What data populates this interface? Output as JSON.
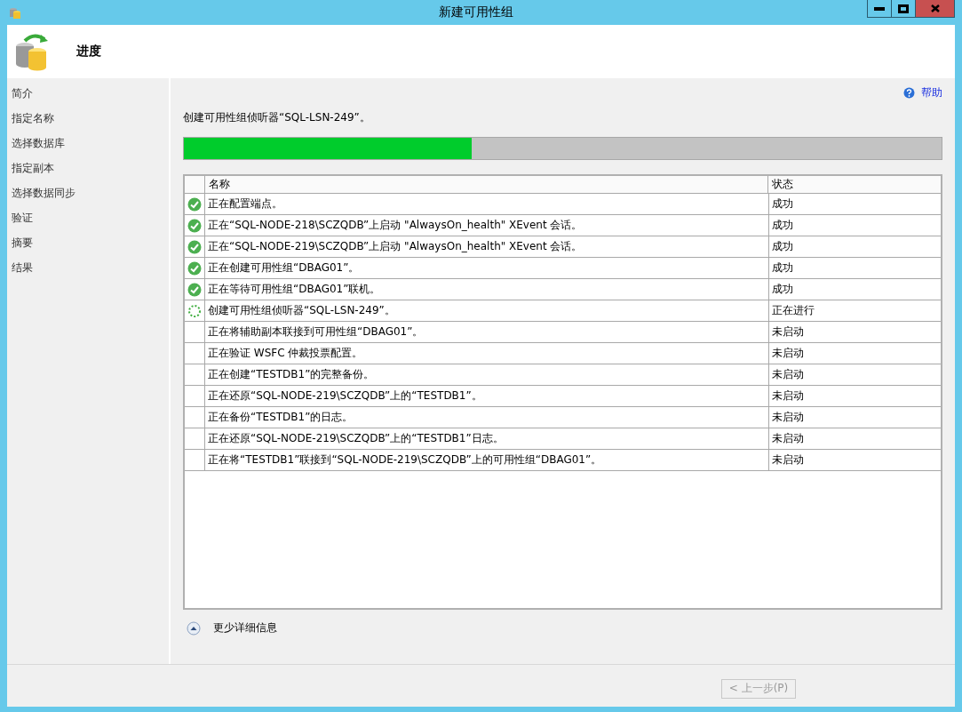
{
  "window": {
    "title": "新建可用性组"
  },
  "header": {
    "title": "进度"
  },
  "sidebar": {
    "items": [
      {
        "label": "简介",
        "selected": false
      },
      {
        "label": "指定名称",
        "selected": false
      },
      {
        "label": "选择数据库",
        "selected": false
      },
      {
        "label": "指定副本",
        "selected": false
      },
      {
        "label": "选择数据同步",
        "selected": false
      },
      {
        "label": "验证",
        "selected": false
      },
      {
        "label": "摘要",
        "selected": false
      },
      {
        "label": "结果",
        "selected": false
      }
    ]
  },
  "help_link": "帮助",
  "current_step": "创建可用性组侦听器“SQL-LSN-249”。",
  "progress": {
    "level": 0.38
  },
  "table": {
    "columns": [
      "名称",
      "状态"
    ],
    "rows": [
      {
        "kind": "done",
        "name": "正在配置端点。",
        "status": "成功"
      },
      {
        "kind": "done",
        "name": "正在“SQL-NODE-218\\SCZQDB”上启动 \"AlwaysOn_health\" XEvent 会话。",
        "status": "成功"
      },
      {
        "kind": "done",
        "name": "正在“SQL-NODE-219\\SCZQDB”上启动 \"AlwaysOn_health\" XEvent 会话。",
        "status": "成功"
      },
      {
        "kind": "done",
        "name": "正在创建可用性组“DBAG01”。",
        "status": "成功"
      },
      {
        "kind": "done",
        "name": "正在等待可用性组“DBAG01”联机。",
        "status": "成功"
      },
      {
        "kind": "running",
        "name": "创建可用性组侦听器“SQL-LSN-249”。",
        "status": "正在进行"
      },
      {
        "kind": "pending",
        "name": "正在将辅助副本联接到可用性组“DBAG01”。",
        "status": "未启动"
      },
      {
        "kind": "pending",
        "name": "正在验证 WSFC 仲裁投票配置。",
        "status": "未启动"
      },
      {
        "kind": "pending",
        "name": "正在创建“TESTDB1”的完整备份。",
        "status": "未启动"
      },
      {
        "kind": "pending",
        "name": "正在还原“SQL-NODE-219\\SCZQDB”上的“TESTDB1”。",
        "status": "未启动"
      },
      {
        "kind": "pending",
        "name": "正在备份“TESTDB1”的日志。",
        "status": "未启动"
      },
      {
        "kind": "pending",
        "name": "正在还原“SQL-NODE-219\\SCZQDB”上的“TESTDB1”日志。",
        "status": "未启动"
      },
      {
        "kind": "pending",
        "name": "正在将“TESTDB1”联接到“SQL-NODE-219\\SCZQDB”上的可用性组“DBAG01”。",
        "status": "未启动"
      }
    ]
  },
  "details_toggle": {
    "label": "更少详细信息",
    "expanded": true
  },
  "buttons": [
    {
      "label": "< 上一步(P)",
      "disabled": true
    }
  ]
}
